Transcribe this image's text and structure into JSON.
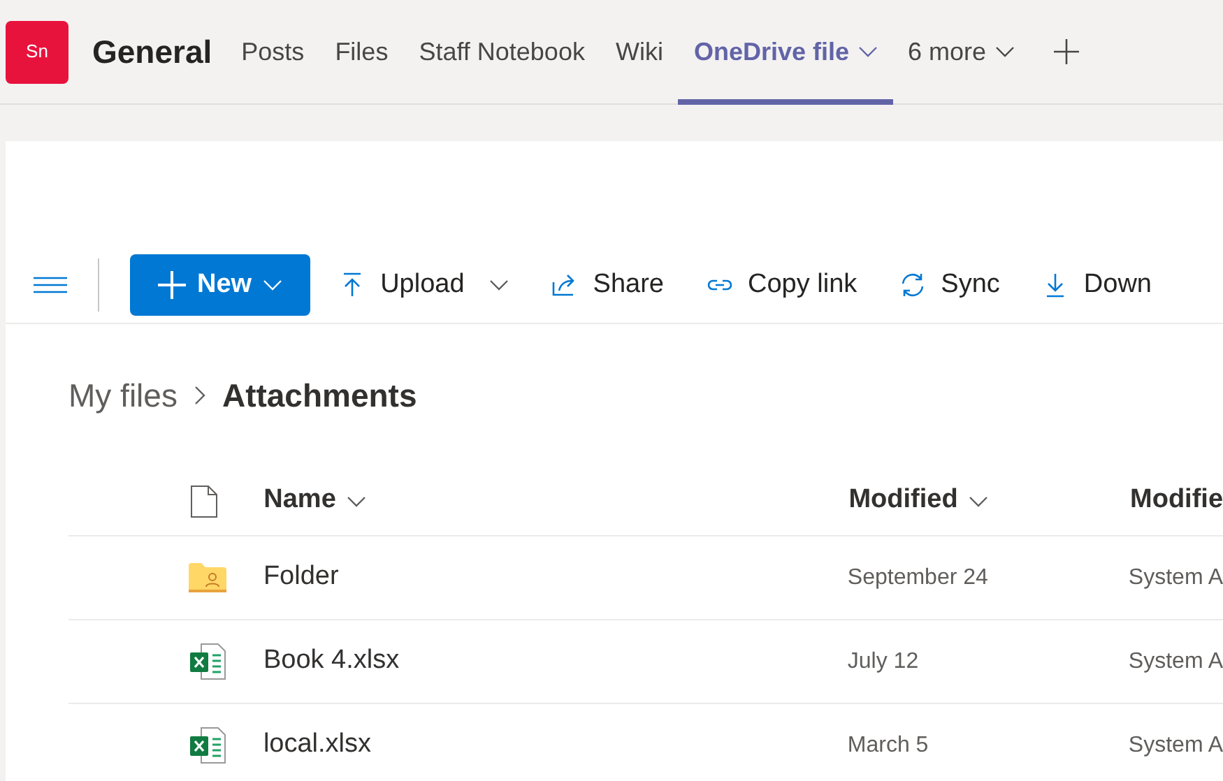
{
  "header": {
    "avatar": "Sn",
    "channel": "General",
    "tabs": [
      {
        "label": "Posts",
        "selected": false,
        "dropdown": false
      },
      {
        "label": "Files",
        "selected": false,
        "dropdown": false
      },
      {
        "label": "Staff Notebook",
        "selected": false,
        "dropdown": false
      },
      {
        "label": "Wiki",
        "selected": false,
        "dropdown": false
      },
      {
        "label": "OneDrive file",
        "selected": true,
        "dropdown": true
      },
      {
        "label": "6 more",
        "selected": false,
        "dropdown": true
      }
    ]
  },
  "toolbar": {
    "new_button": "New",
    "actions": [
      {
        "kind": "upload",
        "label": "Upload",
        "dropdown": true
      },
      {
        "kind": "share",
        "label": "Share",
        "dropdown": false
      },
      {
        "kind": "link",
        "label": "Copy link",
        "dropdown": false
      },
      {
        "kind": "sync",
        "label": "Sync",
        "dropdown": false
      },
      {
        "kind": "download",
        "label": "Down",
        "dropdown": false
      }
    ]
  },
  "breadcrumb": {
    "parent": "My files",
    "current": "Attachments"
  },
  "table": {
    "columns": [
      "Name",
      "Modified",
      "Modifie"
    ],
    "rows": [
      {
        "kind": "folder",
        "name": "Folder",
        "modified": "September 24",
        "modified_by": "System A"
      },
      {
        "kind": "excel",
        "name": "Book 4.xlsx",
        "modified": "July 12",
        "modified_by": "System A"
      },
      {
        "kind": "excel",
        "name": "local.xlsx",
        "modified": "March 5",
        "modified_by": "System A"
      }
    ]
  }
}
